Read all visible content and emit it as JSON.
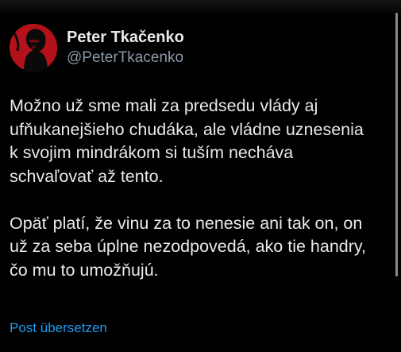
{
  "author": {
    "display_name": "Peter Tkačenko",
    "handle": "@PeterTkacenko",
    "avatar_icon": "profile-avatar",
    "avatar_color": "#b3121a"
  },
  "post": {
    "paragraphs": [
      "Možno už sme mali za predsedu vlády aj\nufňukanejšieho chudáka, ale vládne uznesenia\nk svojim mindrákom si tuším nechá­va\nschvaľovať až tento.",
      "Opäť platí, že vinu za to nenesie ani tak on, on\nuž za seba úplne nezodpovedá, ako tie handry,\nčo mu to umožňujú."
    ]
  },
  "actions": {
    "translate_label": "Post übersetzen"
  },
  "colors": {
    "background": "#000000",
    "text": "#e7e9ea",
    "secondary": "#8b98a5",
    "link": "#1d9bf0"
  }
}
